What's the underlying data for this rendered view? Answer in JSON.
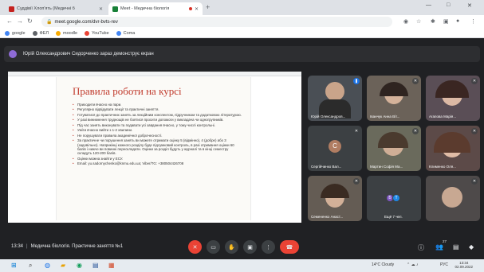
{
  "browser": {
    "tabs": [
      {
        "title": "Суддівії Хлоп'ять (Медичні б",
        "active": false,
        "favicon_color": "#c5221f"
      },
      {
        "title": "Meet - Медична біологія",
        "active": true,
        "favicon_color": "#188038"
      }
    ],
    "new_tab": "+",
    "window_controls": [
      "—",
      "□",
      "✕"
    ],
    "url": "meet.google.com/dvr-bvts-rev",
    "bookmarks": [
      {
        "label": "google",
        "color": "#4285f4"
      },
      {
        "label": "ФЕЛ",
        "color": "#5f6368"
      },
      {
        "label": "moodle",
        "color": "#f9ab00"
      },
      {
        "label": "YouTube",
        "color": "#ea4335"
      },
      {
        "label": "Coma",
        "color": "#4285f4"
      }
    ]
  },
  "banner": {
    "text": "Юрій Олександрович Сидорченко зараз демонструє екран"
  },
  "slide": {
    "title": "Правила роботи на курсі",
    "rules": [
      "Приходити вчасно на пари.",
      "Регулярно відвідувати лекції та практичні заняття.",
      "Готуватися до практичних занять за лекційним конспектом, підручником та додатковою літературою.",
      "У разі виникнення труднощів не боятися просити допомоги у викладача чи одногрупників.",
      "Під час занять виконувати та подавати усі завдання вчасно, у тому числі контрольні.",
      "Уміти вчасно вийти з 1-2 хвилини.",
      "Не порушувати правила академічної доброчесності.",
      "За практичне чи порушення занять ви можете отримати оцінку 5 (відмінно), 4 (добре) або 3 (задовільно). Наприкінці кожного розділу буде підсумковий контроль, в разі отримання оцінки 60 балів і нижче ви повинні перескладати. Оцінки за розділ будуть у журналі та в кінці семестру складуть 120-200 балів.",
      "Оцінки можна знайти у ЕСУ.",
      "Email: yu.sadornychenko@knmu.edu.ua; Viber/TG: +380504426708"
    ]
  },
  "participants": [
    {
      "name": "Юрій Олександров...",
      "mic": "speaking",
      "bg": "#4a4f55"
    },
    {
      "name": "Іванчук Анна Віт...",
      "mic": "muted",
      "bg": "#6b6259"
    },
    {
      "name": "Агапова Марія...",
      "mic": "muted",
      "bg": "#5a4e56"
    },
    {
      "name": "Сергійчинко Вал...",
      "mic": "muted",
      "bg": "#3c4043",
      "letter": "С",
      "letter_color": "#b07d62"
    },
    {
      "name": "Мартин Софія Ма...",
      "mic": "muted",
      "bg": "#6a6a5c"
    },
    {
      "name": "Клименко Оля...",
      "mic": "muted",
      "bg": "#5c4a48"
    },
    {
      "name": "Семененко Анаст...",
      "mic": "muted",
      "bg": "#645c54"
    },
    {
      "name": "Ещё 7 чел.",
      "mic": "none",
      "bg": "#3c4043",
      "more": [
        "Б",
        "Т"
      ]
    },
    {
      "name": "",
      "mic": "muted",
      "bg": "#4e4a4a"
    }
  ],
  "meeting": {
    "time": "13:34",
    "title": "Медична біологія. Практичне заняття №1",
    "participant_count": "27"
  },
  "taskbar": {
    "weather": "14°C  Cloudy",
    "lang": "РУС",
    "time": "13:34",
    "date": "02.09.2022"
  }
}
